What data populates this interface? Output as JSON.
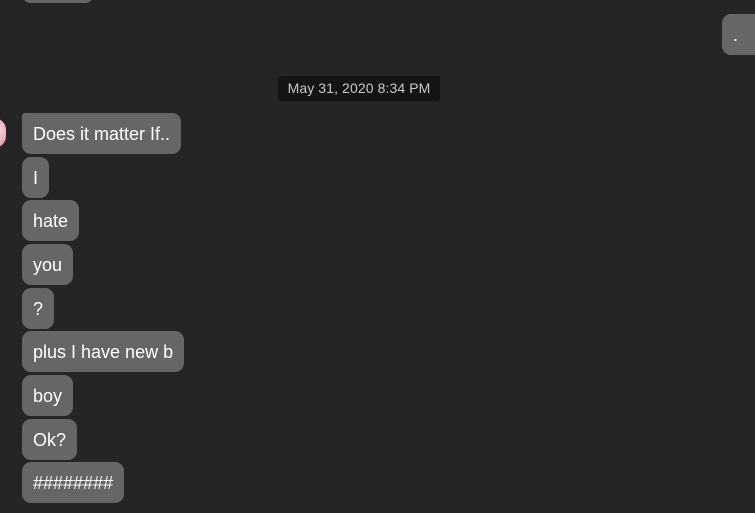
{
  "conversation": {
    "timestamp": "May 31, 2020 8:34 PM",
    "sent_messages": [
      {
        "text": "."
      }
    ],
    "received_messages": [
      {
        "text": "Does it matter If.."
      },
      {
        "text": "I"
      },
      {
        "text": "hate"
      },
      {
        "text": "you"
      },
      {
        "text": "?"
      },
      {
        "text": "plus I have new b"
      },
      {
        "text": "boy"
      },
      {
        "text": "Ok?"
      },
      {
        "text": "########"
      }
    ]
  },
  "colors": {
    "background": "#252527",
    "bubble": "#666667",
    "timestamp_bg": "#141416",
    "text": "#ffffff"
  }
}
